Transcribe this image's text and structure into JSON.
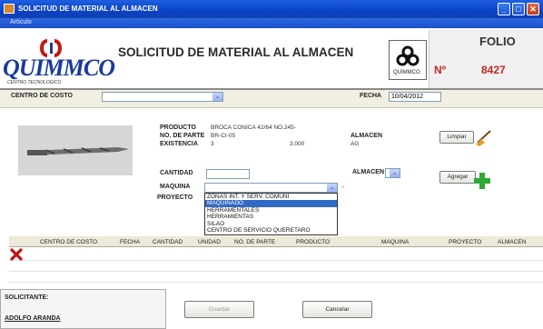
{
  "window": {
    "title": "SOLICITUD DE MATERIAL AL ALMACEN",
    "controls": {
      "minimize": "_",
      "maximize": "□",
      "close": "✕"
    }
  },
  "menu": {
    "items": [
      "Artículo"
    ]
  },
  "header": {
    "logo_text": "QUIMMCO",
    "logo_subtitle": "CENTRO TECNOLOGICO",
    "title": "SOLICITUD DE MATERIAL AL ALMACEN",
    "small_logo_text": "QUİMMCO",
    "folio_label": "FOLIO",
    "folio_prefix": "Nº",
    "folio_number": "8427"
  },
  "filters": {
    "centro_label": "CENTRO DE COSTO",
    "centro_value": "",
    "fecha_label": "FECHA",
    "fecha_value": "10/04/2012"
  },
  "product": {
    "producto_label": "PRODUCTO",
    "producto_value": "BROCA CONICA 42/64 NO.245-",
    "parte_label": "NO. DE PARTE",
    "parte_value": "BR-CI-05",
    "existencia_label": "EXISTENCIA",
    "existencia_a": "3",
    "existencia_b": "3.000",
    "almacen_label": "ALMACEN",
    "almacen_value": "AG"
  },
  "form": {
    "cantidad_label": "CANTIDAD",
    "cantidad_value": "",
    "almacen_label": "ALMACEN",
    "maquina_label": "MAQUINA",
    "proyecto_label": "PROYECTO",
    "arrow_glyph": "→"
  },
  "buttons": {
    "limpiar": "Limpiar",
    "agregar": "Agregar",
    "guardar": "Guardar",
    "cancelar": "Cancelar"
  },
  "dropdown_options": [
    "ZONAS INT. Y SERV. COMUNI",
    "MAQUINADO",
    "HERRAMENTALES",
    "HERRAMIENTAS",
    "SILAO",
    "CENTRO DE SERVICIO QUERETARO"
  ],
  "dropdown_selected_index": 1,
  "table": {
    "columns": [
      "CENTRO DE COSTO",
      "FECHA",
      "CANTIDAD",
      "UNIDAD",
      "NO. DE PARTE",
      "PRODUCTO",
      "MAQUINA",
      "PROYECTO",
      "ALMACEN"
    ]
  },
  "solicitante": {
    "label": "SOLICITANTE:",
    "name": "ADOLFO ARANDA"
  },
  "colors": {
    "accent": "#0a42c6",
    "folio": "#c02820",
    "selection": "#316ac5"
  }
}
